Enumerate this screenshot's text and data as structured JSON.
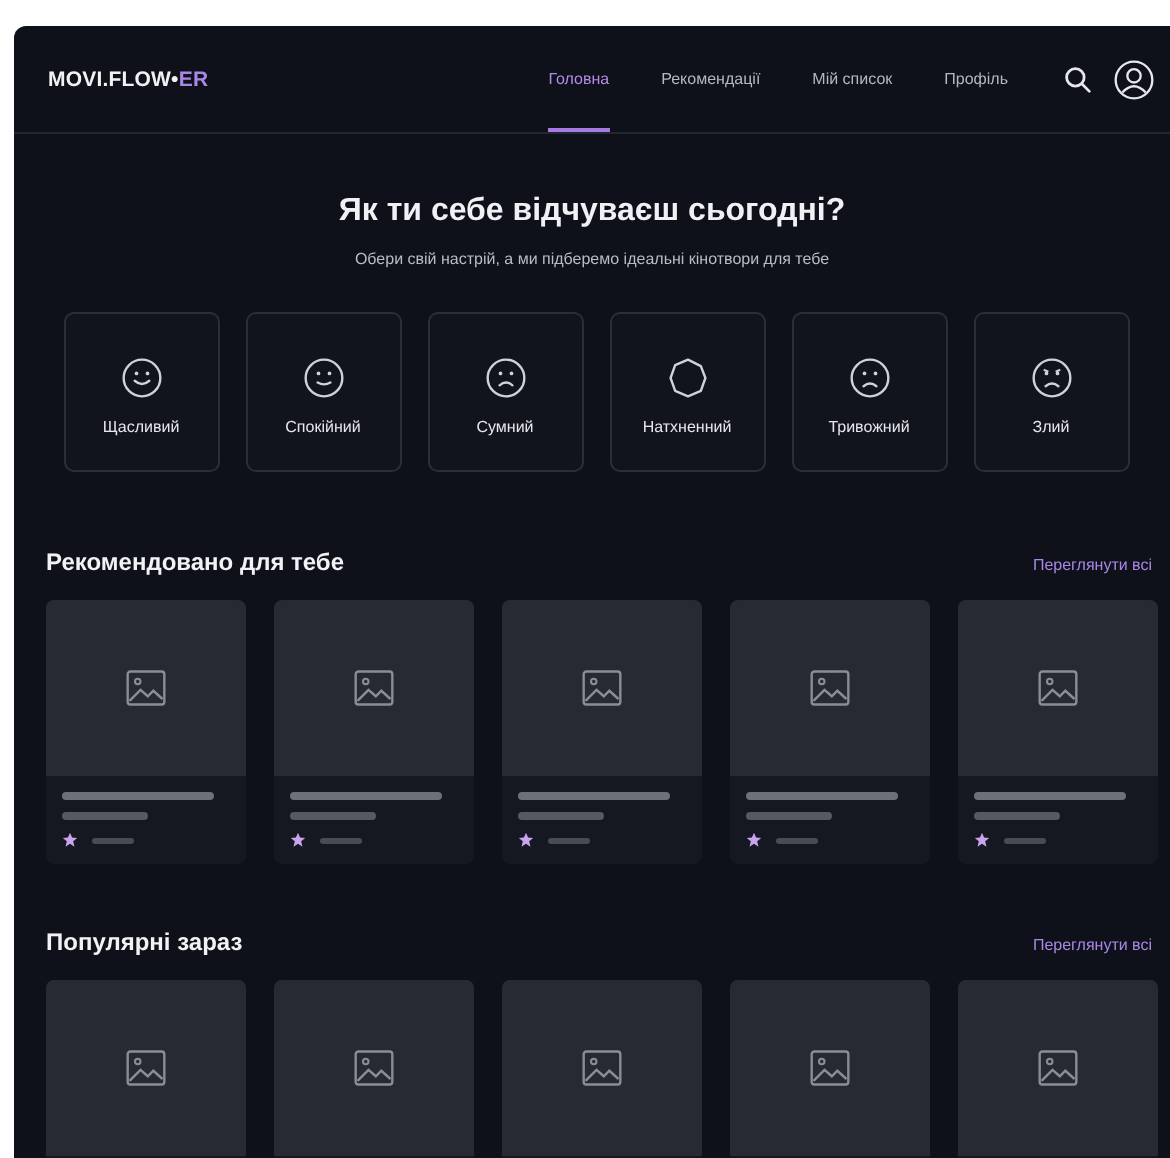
{
  "logo": {
    "text": "MOVI.FLOW•",
    "accent": "ER"
  },
  "nav": [
    {
      "label": "Головна",
      "selected": true
    },
    {
      "label": "Рекомендації",
      "selected": false
    },
    {
      "label": "Мій список",
      "selected": false
    },
    {
      "label": "Профіль",
      "selected": false
    }
  ],
  "hero": {
    "title": "Як ти себе відчуваєш сьогодні?",
    "subtitle": "Обери свій настрій, а ми підберемо ідеальні кінотвори для тебе"
  },
  "moods": [
    {
      "label": "Щасливий",
      "kind": "happy"
    },
    {
      "label": "Спокійний",
      "kind": "calm"
    },
    {
      "label": "Сумний",
      "kind": "sad"
    },
    {
      "label": "Натхненний",
      "kind": "inspired"
    },
    {
      "label": "Тривожний",
      "kind": "anxious"
    },
    {
      "label": "Злий",
      "kind": "angry"
    }
  ],
  "sections": [
    {
      "title": "Рекомендовано для тебе",
      "link": "Переглянути всі",
      "cards": [
        {
          "kind": "skeleton"
        },
        {
          "kind": "skeleton"
        },
        {
          "kind": "skeleton"
        },
        {
          "kind": "skeleton"
        },
        {
          "kind": "skeleton"
        }
      ]
    },
    {
      "title": "Популярні зараз",
      "link": "Переглянути всі",
      "cards": [
        {
          "kind": "poster_only"
        },
        {
          "kind": "poster_only"
        },
        {
          "kind": "poster_only"
        },
        {
          "kind": "poster_only"
        },
        {
          "kind": "poster_only"
        }
      ]
    }
  ]
}
